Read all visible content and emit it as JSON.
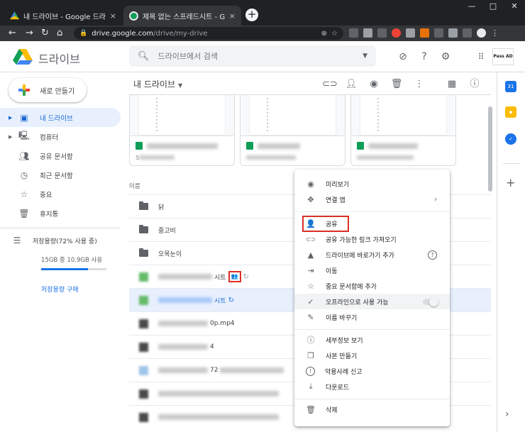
{
  "browser": {
    "tabs": [
      {
        "title": "내 드라이브 - Google 드라이브",
        "close": "×"
      },
      {
        "title": "제목 없는 스프레드시트 - Googl",
        "close": "×"
      }
    ],
    "new_tab": "+",
    "url_host": "drive.google.com",
    "url_path": "/drive/my-drive",
    "window_controls": [
      "—",
      "□",
      "✕"
    ]
  },
  "header": {
    "app_name": "드라이브",
    "search_placeholder": "드라이브에서 검색",
    "brand_logo_text": "Pass AD"
  },
  "sidebar": {
    "new_button": "새로 만들기",
    "items": [
      {
        "label": "내 드라이브",
        "icon": "my-drive-icon",
        "active": true
      },
      {
        "label": "컴퓨터",
        "icon": "computer-icon",
        "active": false
      },
      {
        "label": "공유 문서함",
        "icon": "shared-icon",
        "active": false
      },
      {
        "label": "최근 문서함",
        "icon": "clock-icon",
        "active": false
      },
      {
        "label": "중요",
        "icon": "star-icon",
        "active": false
      },
      {
        "label": "휴지통",
        "icon": "trash-icon",
        "active": false
      }
    ],
    "storage": {
      "label": "저장용량(72% 사용 중)",
      "used_text": "15GB 중 10.9GB 사용",
      "fraction": 0.72,
      "buy_link": "저장용량 구매"
    }
  },
  "main": {
    "breadcrumb": "내 드라이브",
    "name_column": "이름",
    "rows": [
      {
        "type": "folder",
        "name": "닭"
      },
      {
        "type": "folder",
        "name": "중고비"
      },
      {
        "type": "folder",
        "name": "오목눈이"
      },
      {
        "type": "sheet",
        "name_suffix": "시트",
        "shared_badge": "👥",
        "sync": "↻"
      },
      {
        "type": "sheet",
        "name_suffix": "시트",
        "sync": "↻",
        "selected": true
      },
      {
        "type": "video",
        "name_suffix": "0p.mp4"
      },
      {
        "type": "video",
        "name_suffix": "4"
      },
      {
        "type": "file",
        "name_suffix": "72"
      },
      {
        "type": "file",
        "name_suffix": ""
      },
      {
        "type": "file",
        "name_suffix": ""
      }
    ],
    "cards": [
      {
        "sub": "S"
      },
      {
        "sub": ""
      },
      {
        "sub": ""
      }
    ]
  },
  "context_menu": {
    "items": [
      {
        "label": "미리보기",
        "icon": "eye-icon",
        "glyph": "◉"
      },
      {
        "label": "연결 앱",
        "icon": "move-arrows-icon",
        "glyph": "✥",
        "submenu": "›"
      },
      {
        "label": "공유",
        "icon": "person-add-icon",
        "glyph": "👤",
        "highlight_box": true
      },
      {
        "label": "공유 가능한 링크 가져오기",
        "icon": "link-icon",
        "glyph": "⊂⊃"
      },
      {
        "label": "드라이브에 바로가기 추가",
        "icon": "drive-shortcut-icon",
        "glyph": "▲",
        "help": "?"
      },
      {
        "label": "이동",
        "icon": "move-to-folder-icon",
        "glyph": "⇥"
      },
      {
        "label": "중요 문서함에 추가",
        "icon": "star-icon",
        "glyph": "☆"
      },
      {
        "label": "오프라인으로 사용 가능",
        "icon": "offline-check-icon",
        "glyph": "✓",
        "toggle": true,
        "toggle_on": false
      },
      {
        "label": "이름 바꾸기",
        "icon": "pencil-icon",
        "glyph": "✎"
      },
      {
        "label": "세부정보 보기",
        "icon": "info-icon",
        "glyph": "ⓘ"
      },
      {
        "label": "사본 만들기",
        "icon": "copy-icon",
        "glyph": "❐"
      },
      {
        "label": "악용사례 신고",
        "icon": "report-icon",
        "glyph": "!"
      },
      {
        "label": "다운로드",
        "icon": "download-icon",
        "glyph": "⤓"
      },
      {
        "label": "삭제",
        "icon": "trash-icon",
        "glyph": "🗑"
      }
    ]
  },
  "colors": {
    "accent": "#1a73e8",
    "selected_bg": "#e8f0fe",
    "annotation_red": "#d93025",
    "chrome_dark": "#202124"
  }
}
